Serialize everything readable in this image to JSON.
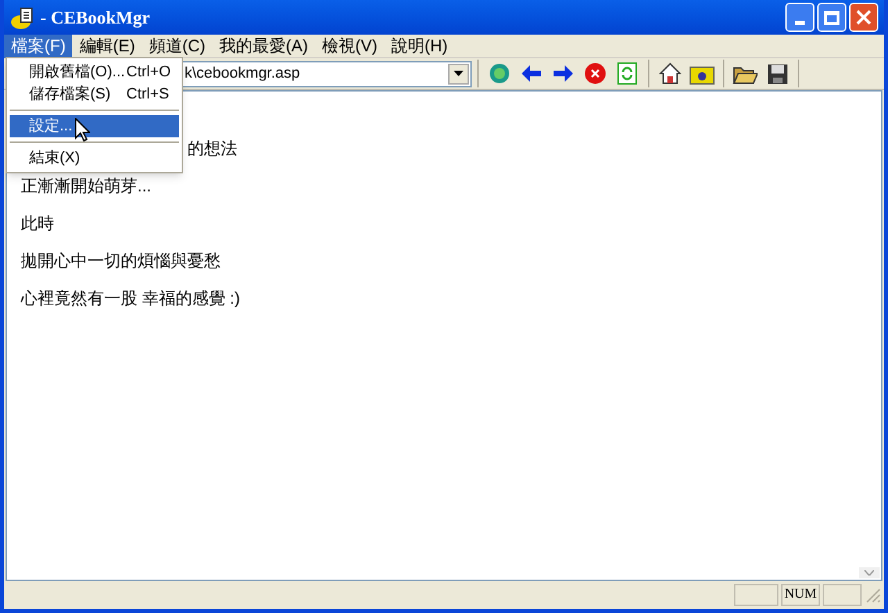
{
  "window": {
    "title": "- CEBookMgr"
  },
  "menu_bar": [
    {
      "label": "檔案(F)",
      "selected": true
    },
    {
      "label": "編輯(E)",
      "selected": false
    },
    {
      "label": "頻道(C)",
      "selected": false
    },
    {
      "label": "我的最愛(A)",
      "selected": false
    },
    {
      "label": "檢視(V)",
      "selected": false
    },
    {
      "label": "說明(H)",
      "selected": false
    }
  ],
  "file_menu": [
    {
      "kind": "item",
      "label": "開啟舊檔(O)...",
      "shortcut": "Ctrl+O",
      "selected": false
    },
    {
      "kind": "item",
      "label": "儲存檔案(S)",
      "shortcut": "Ctrl+S",
      "selected": false
    },
    {
      "kind": "separator"
    },
    {
      "kind": "item",
      "label": "設定...",
      "selected": true
    },
    {
      "kind": "separator"
    },
    {
      "kind": "item",
      "label": "結束(X)",
      "selected": false
    }
  ],
  "address": {
    "value": "k\\cebookmgr.asp"
  },
  "content": [
    {
      "kind": "partial",
      "text": "的想法"
    },
    {
      "kind": "line",
      "text": "正漸漸開始萌芽..."
    },
    {
      "kind": "line",
      "text": "此時"
    },
    {
      "kind": "line",
      "text": "拋開心中一切的煩惱與憂愁"
    },
    {
      "kind": "line",
      "text": "心裡竟然有一股 幸福的感覺 :)"
    }
  ],
  "status_bar": {
    "indicator": "NUM"
  }
}
